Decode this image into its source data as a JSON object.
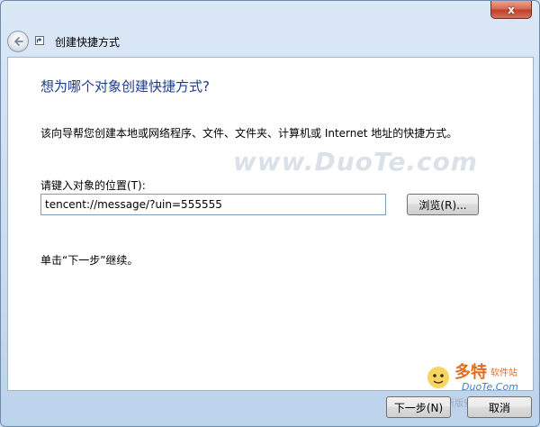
{
  "window": {
    "title": "创建快捷方式",
    "close_glyph": "x"
  },
  "content": {
    "heading": "想为哪个对象创建快捷方式?",
    "description": "该向导帮您创建本地或网络程序、文件、文件夹、计算机或 Internet 地址的快捷方式。",
    "field_label": "请键入对象的位置(T):",
    "field_value": "tencent://message/?uin=555555",
    "browse_label": "浏览(R)...",
    "hint": "单击“下一步”继续。"
  },
  "watermark": {
    "site": "www.DuoTe.com",
    "logo_name": "多特",
    "logo_sub": "软件站",
    "logo_url": "DuoTe.Com",
    "logo_overlay": "新版安全下载文件站"
  },
  "footer": {
    "next_label": "下一步(N)",
    "cancel_label": "取消"
  },
  "icons": {
    "back": "back-arrow-icon",
    "shortcut": "shortcut-arrow-icon",
    "close": "close-icon"
  },
  "colors": {
    "heading": "#1e3c8c",
    "close_button": "#c0402b",
    "frame": "#c9dcf0"
  }
}
